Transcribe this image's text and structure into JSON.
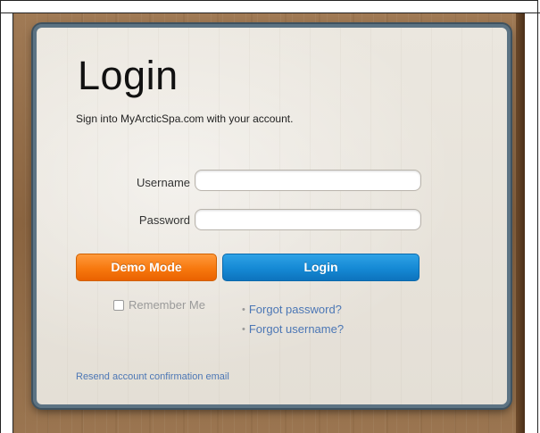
{
  "login": {
    "title": "Login",
    "subtitle": "Sign into MyArcticSpa.com with your account.",
    "username_label": "Username",
    "username_value": "",
    "password_label": "Password",
    "password_value": "",
    "demo_button": "Demo Mode",
    "login_button": "Login",
    "remember_label": "Remember Me",
    "forgot_password": "Forgot password?",
    "forgot_username": "Forgot username?",
    "resend_link": "Resend account confirmation email",
    "bullet": "•"
  },
  "colors": {
    "demo_button": "#f7780e",
    "login_button": "#1589d4",
    "link": "#4c77b5",
    "card_border": "#5c7383"
  }
}
